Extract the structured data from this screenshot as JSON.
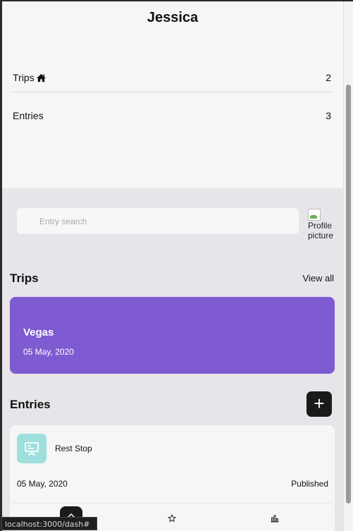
{
  "profile": {
    "name": "Jessica",
    "trips_label": "Trips",
    "trips_count": "2",
    "entries_label": "Entries",
    "entries_count": "3"
  },
  "search": {
    "placeholder": "Entry search",
    "profile_picture_alt": "Profile picture"
  },
  "trips_section": {
    "title": "Trips",
    "view_all": "View all",
    "cards": [
      {
        "name": "Vegas",
        "date": "05 May, 2020",
        "color": "#7e5bd0"
      }
    ]
  },
  "entries_section": {
    "title": "Entries",
    "add_label": "+",
    "items": [
      {
        "title": "Rest Stop",
        "date": "05 May, 2020",
        "status": "Published",
        "thumb_color": "#9fe0de",
        "icon": "presentation-board-icon"
      }
    ]
  },
  "bottom_nav": {
    "items": [
      "home-icon",
      "star-icon",
      "stats-icon"
    ]
  },
  "status_bar": {
    "url": "localhost:3000/dash#"
  }
}
